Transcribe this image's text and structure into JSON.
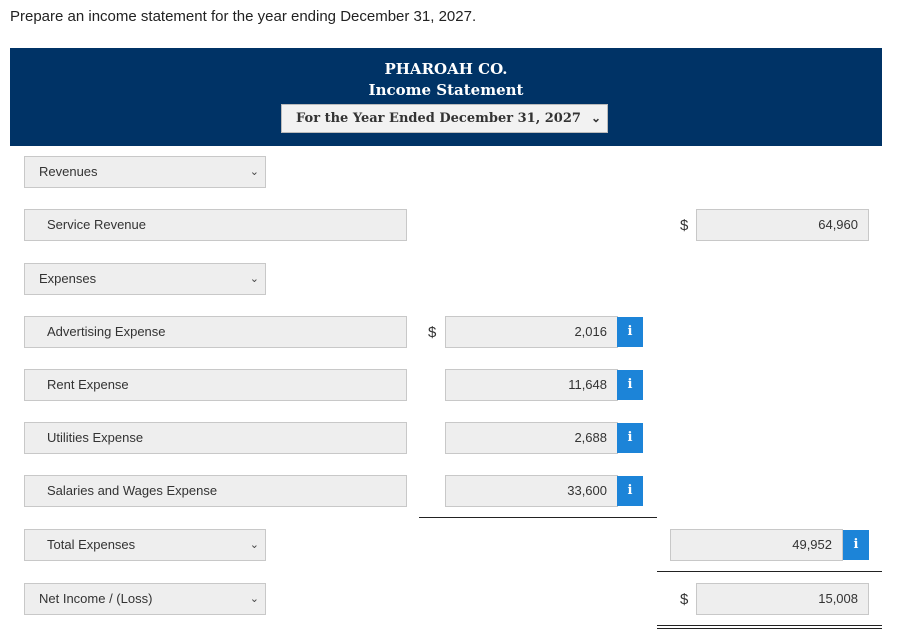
{
  "prompt": "Prepare an income statement for the year ending December 31, 2027.",
  "header": {
    "company": "PHAROAH CO.",
    "title": "Income Statement",
    "period": "For the Year Ended December 31, 2027"
  },
  "rows": {
    "revenues_label": "Revenues",
    "service_revenue": {
      "label": "Service Revenue",
      "currency": "$",
      "amount": "64,960"
    },
    "expenses_label": "Expenses",
    "advertising": {
      "label": "Advertising Expense",
      "currency": "$",
      "amount": "2,016"
    },
    "rent": {
      "label": "Rent Expense",
      "amount": "11,648"
    },
    "utilities": {
      "label": "Utilities Expense",
      "amount": "2,688"
    },
    "salaries": {
      "label": "Salaries and Wages Expense",
      "amount": "33,600"
    },
    "total_expenses": {
      "label": "Total Expenses",
      "amount": "49,952"
    },
    "net_income": {
      "label": "Net Income / (Loss)",
      "currency": "$",
      "amount": "15,008"
    }
  },
  "info_glyph": "i",
  "select_chevron": "❯"
}
